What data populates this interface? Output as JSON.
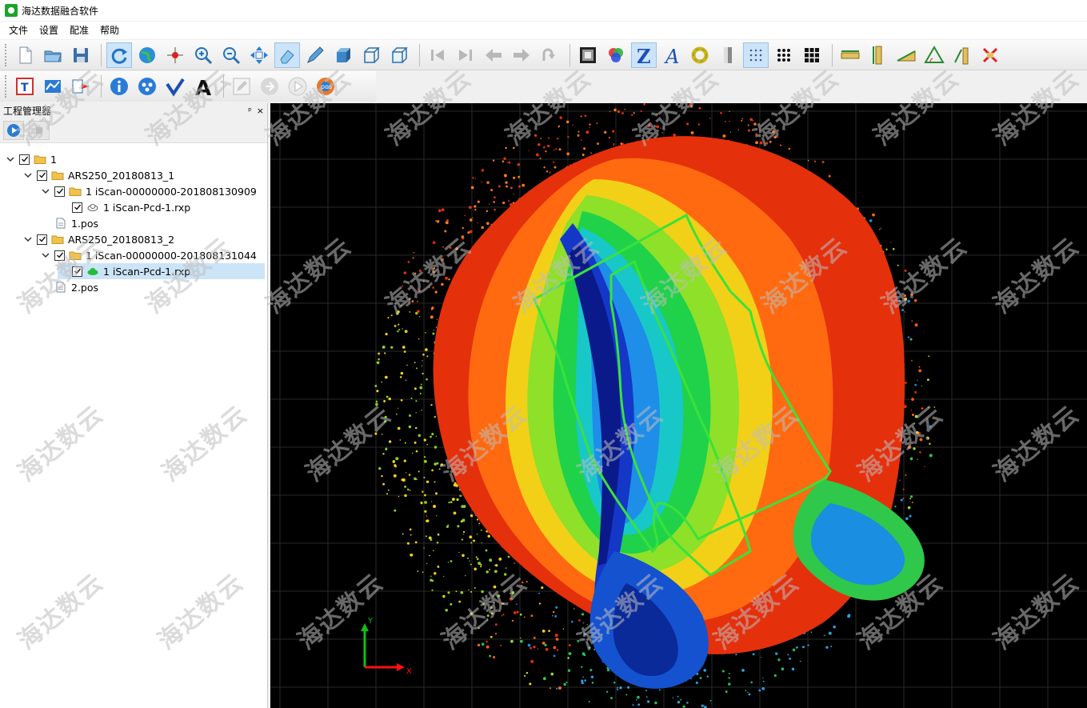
{
  "window": {
    "title": "海达数据融合软件"
  },
  "menu": {
    "items": [
      "文件",
      "设置",
      "配准",
      "帮助"
    ]
  },
  "toolbar1": {
    "groups": [
      [
        "new-file-icon",
        "open-folder-icon",
        "save-icon"
      ],
      [
        "refresh-icon",
        "globe-icon",
        "point-pick-icon",
        "zoom-in-icon",
        "zoom-out-icon",
        "zoom-extent-icon",
        "eraser-icon",
        "pen-icon",
        "cube-solid-icon",
        "cube-wire-icon",
        "cube-outline-icon"
      ],
      [
        "step-first-icon",
        "step-last-icon",
        "arrow-left-icon",
        "arrow-right-icon",
        "rotate-icon"
      ],
      [
        "gray-square-icon",
        "rgb-color-icon",
        "color-z-icon",
        "color-a-icon",
        "ring-icon",
        "gray-bar-icon",
        "dots-sparse-icon",
        "dots-medium-icon",
        "dots-dense-icon"
      ],
      [
        "measure-ruler-icon",
        "vertical-ruler-icon",
        "slope-icon",
        "angle-icon",
        "height-icon",
        "clear-measure-icon"
      ]
    ],
    "active": [
      "refresh-icon",
      "eraser-icon",
      "color-z-icon",
      "dots-sparse-icon"
    ]
  },
  "toolbar2": {
    "groups": [
      [
        "text-tool-icon",
        "pos-tool-icon",
        "import-tool-icon"
      ],
      [
        "info-icon",
        "network-icon",
        "check-v-icon",
        "text-a-icon"
      ],
      [
        "edit-icon",
        "link-icon",
        "play-icon",
        "pos-badge-icon"
      ]
    ]
  },
  "panel": {
    "title": "工程管理器",
    "controls": [
      "ᵖ",
      "×"
    ],
    "tree": [
      {
        "label": "1",
        "level": 0,
        "type": "folder",
        "expanded": true,
        "checked": true
      },
      {
        "label": "ARS250_20180813_1",
        "level": 1,
        "type": "folder",
        "expanded": true,
        "checked": true
      },
      {
        "label": "1  iScan-00000000-201808130909",
        "level": 2,
        "type": "folder",
        "expanded": true,
        "checked": true
      },
      {
        "label": "1  iScan-Pcd-1.rxp",
        "level": 3,
        "type": "cloud-gray",
        "checked": true
      },
      {
        "label": "1.pos",
        "level": 2,
        "type": "file",
        "checked": null
      },
      {
        "label": "ARS250_20180813_2",
        "level": 1,
        "type": "folder",
        "expanded": true,
        "checked": true
      },
      {
        "label": "1  iScan-00000000-201808131044",
        "level": 2,
        "type": "folder",
        "expanded": true,
        "checked": true
      },
      {
        "label": "1  iScan-Pcd-1.rxp",
        "level": 3,
        "type": "cloud-green",
        "checked": true,
        "selected": true
      },
      {
        "label": "2.pos",
        "level": 2,
        "type": "file",
        "checked": null
      }
    ]
  },
  "viewport": {
    "axis": {
      "x_label": "X",
      "y_label": "Y"
    },
    "colors": {
      "background": "#000000",
      "grid": "#2a2a2a",
      "boundary": "#3ae23a",
      "axis_x": "#ff1010",
      "axis_y": "#10c010"
    }
  },
  "watermark": {
    "text": "海达数云"
  }
}
